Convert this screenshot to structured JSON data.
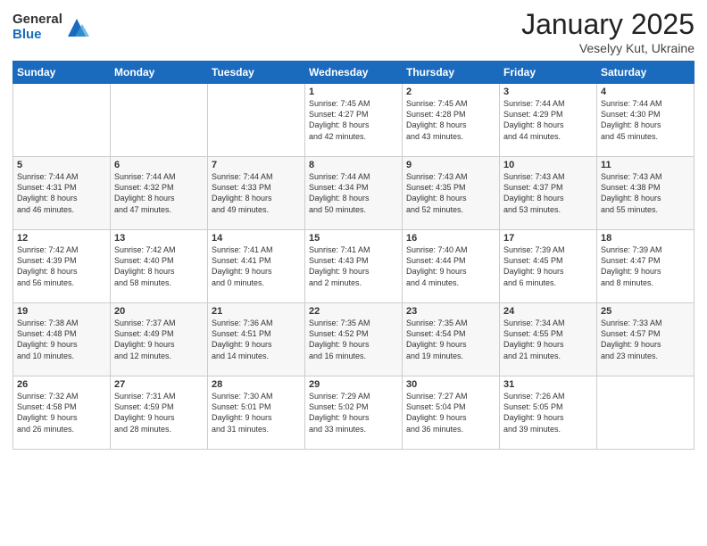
{
  "header": {
    "logo_general": "General",
    "logo_blue": "Blue",
    "month_title": "January 2025",
    "location": "Veselyy Kut, Ukraine"
  },
  "weekdays": [
    "Sunday",
    "Monday",
    "Tuesday",
    "Wednesday",
    "Thursday",
    "Friday",
    "Saturday"
  ],
  "weeks": [
    [
      {
        "day": "",
        "info": ""
      },
      {
        "day": "",
        "info": ""
      },
      {
        "day": "",
        "info": ""
      },
      {
        "day": "1",
        "info": "Sunrise: 7:45 AM\nSunset: 4:27 PM\nDaylight: 8 hours\nand 42 minutes."
      },
      {
        "day": "2",
        "info": "Sunrise: 7:45 AM\nSunset: 4:28 PM\nDaylight: 8 hours\nand 43 minutes."
      },
      {
        "day": "3",
        "info": "Sunrise: 7:44 AM\nSunset: 4:29 PM\nDaylight: 8 hours\nand 44 minutes."
      },
      {
        "day": "4",
        "info": "Sunrise: 7:44 AM\nSunset: 4:30 PM\nDaylight: 8 hours\nand 45 minutes."
      }
    ],
    [
      {
        "day": "5",
        "info": "Sunrise: 7:44 AM\nSunset: 4:31 PM\nDaylight: 8 hours\nand 46 minutes."
      },
      {
        "day": "6",
        "info": "Sunrise: 7:44 AM\nSunset: 4:32 PM\nDaylight: 8 hours\nand 47 minutes."
      },
      {
        "day": "7",
        "info": "Sunrise: 7:44 AM\nSunset: 4:33 PM\nDaylight: 8 hours\nand 49 minutes."
      },
      {
        "day": "8",
        "info": "Sunrise: 7:44 AM\nSunset: 4:34 PM\nDaylight: 8 hours\nand 50 minutes."
      },
      {
        "day": "9",
        "info": "Sunrise: 7:43 AM\nSunset: 4:35 PM\nDaylight: 8 hours\nand 52 minutes."
      },
      {
        "day": "10",
        "info": "Sunrise: 7:43 AM\nSunset: 4:37 PM\nDaylight: 8 hours\nand 53 minutes."
      },
      {
        "day": "11",
        "info": "Sunrise: 7:43 AM\nSunset: 4:38 PM\nDaylight: 8 hours\nand 55 minutes."
      }
    ],
    [
      {
        "day": "12",
        "info": "Sunrise: 7:42 AM\nSunset: 4:39 PM\nDaylight: 8 hours\nand 56 minutes."
      },
      {
        "day": "13",
        "info": "Sunrise: 7:42 AM\nSunset: 4:40 PM\nDaylight: 8 hours\nand 58 minutes."
      },
      {
        "day": "14",
        "info": "Sunrise: 7:41 AM\nSunset: 4:41 PM\nDaylight: 9 hours\nand 0 minutes."
      },
      {
        "day": "15",
        "info": "Sunrise: 7:41 AM\nSunset: 4:43 PM\nDaylight: 9 hours\nand 2 minutes."
      },
      {
        "day": "16",
        "info": "Sunrise: 7:40 AM\nSunset: 4:44 PM\nDaylight: 9 hours\nand 4 minutes."
      },
      {
        "day": "17",
        "info": "Sunrise: 7:39 AM\nSunset: 4:45 PM\nDaylight: 9 hours\nand 6 minutes."
      },
      {
        "day": "18",
        "info": "Sunrise: 7:39 AM\nSunset: 4:47 PM\nDaylight: 9 hours\nand 8 minutes."
      }
    ],
    [
      {
        "day": "19",
        "info": "Sunrise: 7:38 AM\nSunset: 4:48 PM\nDaylight: 9 hours\nand 10 minutes."
      },
      {
        "day": "20",
        "info": "Sunrise: 7:37 AM\nSunset: 4:49 PM\nDaylight: 9 hours\nand 12 minutes."
      },
      {
        "day": "21",
        "info": "Sunrise: 7:36 AM\nSunset: 4:51 PM\nDaylight: 9 hours\nand 14 minutes."
      },
      {
        "day": "22",
        "info": "Sunrise: 7:35 AM\nSunset: 4:52 PM\nDaylight: 9 hours\nand 16 minutes."
      },
      {
        "day": "23",
        "info": "Sunrise: 7:35 AM\nSunset: 4:54 PM\nDaylight: 9 hours\nand 19 minutes."
      },
      {
        "day": "24",
        "info": "Sunrise: 7:34 AM\nSunset: 4:55 PM\nDaylight: 9 hours\nand 21 minutes."
      },
      {
        "day": "25",
        "info": "Sunrise: 7:33 AM\nSunset: 4:57 PM\nDaylight: 9 hours\nand 23 minutes."
      }
    ],
    [
      {
        "day": "26",
        "info": "Sunrise: 7:32 AM\nSunset: 4:58 PM\nDaylight: 9 hours\nand 26 minutes."
      },
      {
        "day": "27",
        "info": "Sunrise: 7:31 AM\nSunset: 4:59 PM\nDaylight: 9 hours\nand 28 minutes."
      },
      {
        "day": "28",
        "info": "Sunrise: 7:30 AM\nSunset: 5:01 PM\nDaylight: 9 hours\nand 31 minutes."
      },
      {
        "day": "29",
        "info": "Sunrise: 7:29 AM\nSunset: 5:02 PM\nDaylight: 9 hours\nand 33 minutes."
      },
      {
        "day": "30",
        "info": "Sunrise: 7:27 AM\nSunset: 5:04 PM\nDaylight: 9 hours\nand 36 minutes."
      },
      {
        "day": "31",
        "info": "Sunrise: 7:26 AM\nSunset: 5:05 PM\nDaylight: 9 hours\nand 39 minutes."
      },
      {
        "day": "",
        "info": ""
      }
    ]
  ]
}
